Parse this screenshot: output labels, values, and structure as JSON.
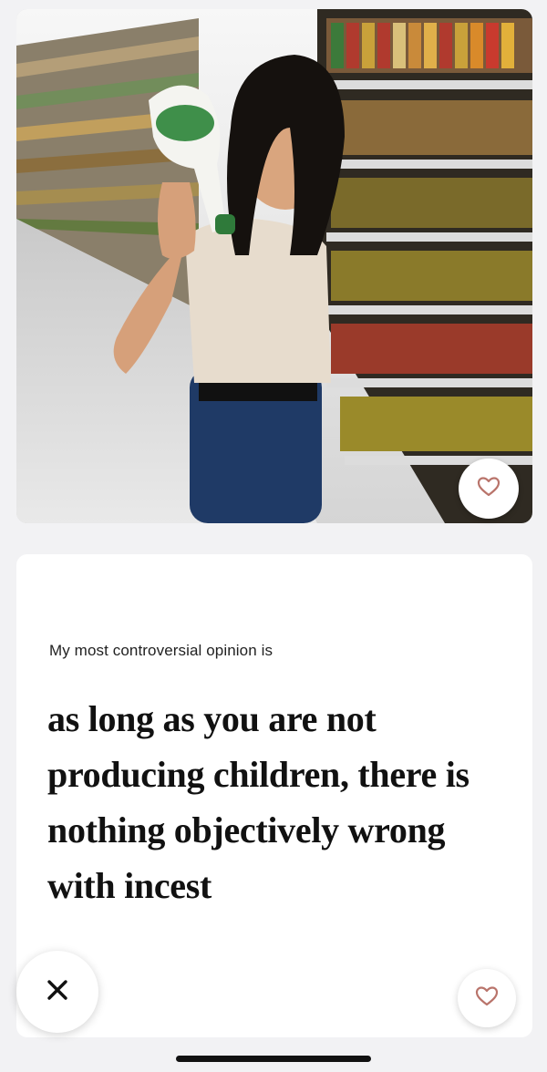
{
  "photo": {
    "description_icon": "profile-photo"
  },
  "prompt": {
    "label": "My most controversial opinion is",
    "answer": "as long as you are not producing children, there is nothing objectively wrong with incest"
  },
  "actions": {
    "pass_icon": "close-icon",
    "like_icon": "heart-icon"
  },
  "colors": {
    "background": "#f2f2f4",
    "card": "#ffffff",
    "heart": "#b9746b",
    "text": "#111111"
  }
}
